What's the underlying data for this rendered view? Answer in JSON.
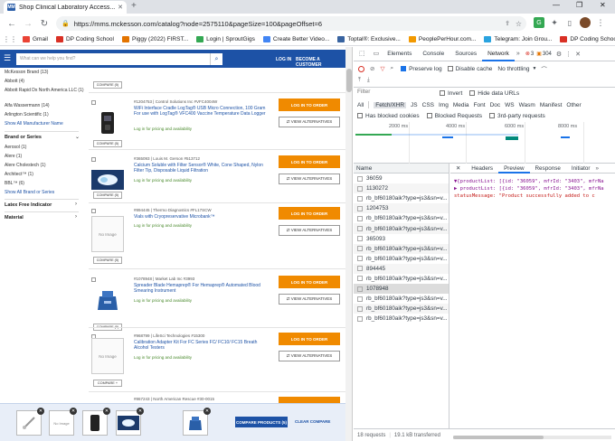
{
  "browser": {
    "tab_title": "Shop Clinical Laboratory Access...",
    "url": "https://mms.mckesson.com/catalog?node=2575110&pageSize=100&pageOffset=6",
    "bookmarks": [
      {
        "label": "Gmail",
        "color": "#ea4335"
      },
      {
        "label": "DP Coding School",
        "color": "#d93025"
      },
      {
        "label": "Piggy (2022) FIRST...",
        "color": "#e37400"
      },
      {
        "label": "Login | SproutGigs",
        "color": "#34a853"
      },
      {
        "label": "Create Better Video...",
        "color": "#4285f4"
      },
      {
        "label": "Toptal®: Exclusive...",
        "color": "#3863a0"
      },
      {
        "label": "PeoplePerHour.com...",
        "color": "#f29900"
      },
      {
        "label": "Telegram: Join Grou...",
        "color": "#2aa3df"
      },
      {
        "label": "DP Coding School",
        "color": "#d93025"
      }
    ]
  },
  "site": {
    "search_placeholder": "What can we help you find?",
    "login_label": "LOG IN",
    "become_customer_label": "BECOME A CUSTOMER",
    "sidebar": {
      "manufacturers": [
        "McKesson Brand (13)",
        "Abbott (4)",
        "Abbott Rapid Dx North America LLC (1)",
        "Alfa Wassermann (14)",
        "Arlington Scientific (1)"
      ],
      "show_all_manufacturer": "Show All Manufacturer Name",
      "brand_heading": "Brand or Series",
      "brands": [
        "Aerosol (1)",
        "Alere (1)",
        "Alere Cholestech (1)",
        "Architect™ (1)",
        "BBL™ (6)"
      ],
      "show_all_brand": "Show All Brand or Series",
      "latex_heading": "Latex Free Indicator",
      "material_heading": "Material"
    },
    "compare_label": "COMPARE (5)",
    "compare_label_plus": "COMPARE +",
    "order_label": "LOG IN TO ORDER",
    "alt_label": "⇄ VIEW ALTERNATIVES",
    "login_pricing": "Log in for pricing and availability",
    "no_image": "No Image",
    "products": [
      {
        "meta": "#1204753 | Control Solutions Inc #VFC4004W",
        "title": "WiFi Interface Cradle LogTag® USB Micro Connection, 100 Gram For use with LogTag® VFC400 Vaccine Temperature Data Logger",
        "login": "Log in for pricing and availability",
        "compare": "COMPARE (5)"
      },
      {
        "meta": "#365093 | Louis M. Gerson #513712",
        "title": "Calcium Soluble with Filter Sensor® White, Cone Shaped, Nylon Filter Tip, Disposable Liquid Filtration",
        "login": "Log in for pricing and availability",
        "compare": "COMPARE (5)"
      },
      {
        "meta": "#894445 | Thermo Diagnostics #FL17SCW",
        "title": "Vials with Cryopreservative Microbank™",
        "login": "Log in for pricing and availability",
        "compare": "COMPARE (5)"
      },
      {
        "meta": "#1078948 | Market Lab Inc #3993",
        "title": "Spreader Blade Hemaprep® For Hemaprep® Automated Blood Smearing Instrument",
        "login": "Log in for pricing and availability",
        "compare": "COMPARE (5)"
      },
      {
        "meta": "#968799 | LifeSci Technologies #15300",
        "title": "Calibration Adapter Kit For FC Series FC/ FC10/ FC15 Breath Alcohol Testers",
        "login": "Log in for pricing and availability",
        "compare": "COMPARE +"
      },
      {
        "meta": "#867243 | North American Rescue #30-0015",
        "title": "",
        "login": "",
        "compare": ""
      }
    ],
    "compare_products_label": "COMPARE PRODUCTS (5)",
    "clear_compare_label": "CLEAR COMPARE",
    "compare_slots": [
      "",
      "No Image",
      "",
      "",
      ""
    ]
  },
  "devtools": {
    "tabs": [
      "Elements",
      "Console",
      "Sources",
      "Network"
    ],
    "active_tab": "Network",
    "error_count": "3",
    "warn_count": "304",
    "preserve_log": "Preserve log",
    "disable_cache": "Disable cache",
    "throttle": "No throttling",
    "filter_placeholder": "Filter",
    "invert": "Invert",
    "hide_data_urls": "Hide data URLs",
    "types": [
      "All",
      "Fetch/XHR",
      "JS",
      "CSS",
      "Img",
      "Media",
      "Font",
      "Doc",
      "WS",
      "Wasm",
      "Manifest",
      "Other"
    ],
    "active_type": "Fetch/XHR",
    "has_blocked_cookies": "Has blocked cookies",
    "blocked_requests": "Blocked Requests",
    "third_party": "3rd-party requests",
    "ticks": [
      "2000 ms",
      "4000 ms",
      "6000 ms",
      "8000 ms"
    ],
    "name_header": "Name",
    "requests": [
      "36059",
      "1130272",
      "rb_bf60180aik?type=js3&sn=v...",
      "1204753",
      "rb_bf60180aik?type=js3&sn=v...",
      "rb_bf60180aik?type=js3&sn=v...",
      "365093",
      "rb_bf60180aik?type=js3&sn=v...",
      "rb_bf60180aik?type=js3&sn=v...",
      "894445",
      "rb_bf60180aik?type=js3&sn=v...",
      "1078948",
      "rb_bf60180aik?type=js3&sn=v...",
      "rb_bf60180aik?type=js3&sn=v...",
      "rb_bf60180aik?type=js3&sn=v..."
    ],
    "selected_request": 11,
    "detail_tabs": [
      "Headers",
      "Preview",
      "Response",
      "Initiator"
    ],
    "active_detail_tab": "Preview",
    "preview_lines": [
      {
        "text": "▼{productList: [{id: \"36059\", mfrId: \"3403\", mfrNa"
      },
      {
        "text": "  ▶ productList: [{id: \"36059\", mfrId: \"3403\", mfrNa"
      },
      {
        "text": "    statusMessage: \"Product successfully added to c"
      }
    ],
    "status_requests": "18 requests",
    "status_transferred": "19.1 kB transferred"
  }
}
